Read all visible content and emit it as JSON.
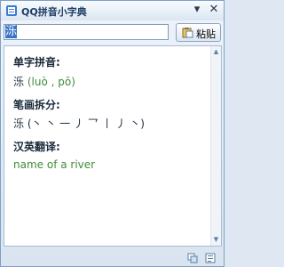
{
  "window": {
    "title": "QQ拼音小字典",
    "minimize_glyph": "▾",
    "close_glyph": "✕"
  },
  "search": {
    "value": "泺"
  },
  "toolbar": {
    "paste_label": "粘贴"
  },
  "entry": {
    "pinyin_heading": "单字拼音:",
    "character": "泺",
    "pinyin": "(luò , pō)",
    "strokes_heading": "笔画拆分:",
    "strokes": "(丶 丶 一 丿 乛 丨 丿 丶)",
    "translation_heading": "汉英翻译:",
    "translation": "name of a river"
  },
  "icons": {
    "app": "dictionary-icon",
    "paste": "clipboard-icon",
    "status_left": "copy-icon",
    "status_right": "list-icon"
  },
  "colors": {
    "accent_green": "#3f8d3a",
    "selection_blue": "#3a74c9"
  }
}
